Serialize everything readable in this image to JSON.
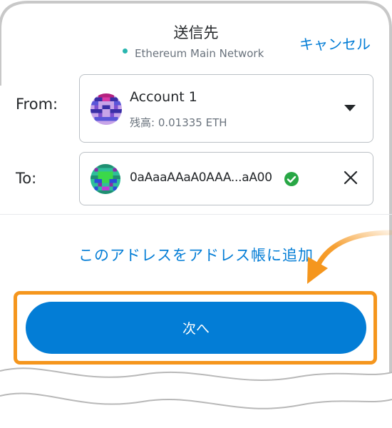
{
  "header": {
    "title": "送信先",
    "network_name": "Ethereum Main Network",
    "cancel_label": "キャンセル"
  },
  "from": {
    "label": "From:",
    "account_name": "Account 1",
    "balance": "残高: 0.01335 ETH"
  },
  "to": {
    "label": "To:",
    "address": "0aAaaAAaA0AAA...aA00"
  },
  "add_to_address_book_label": "このアドレスをアドレス帳に追加",
  "next_button_label": "次へ",
  "colors": {
    "accent": "#037dd6",
    "highlight": "#f5961d",
    "network_dot": "#29b6af",
    "verified": "#28a745"
  }
}
